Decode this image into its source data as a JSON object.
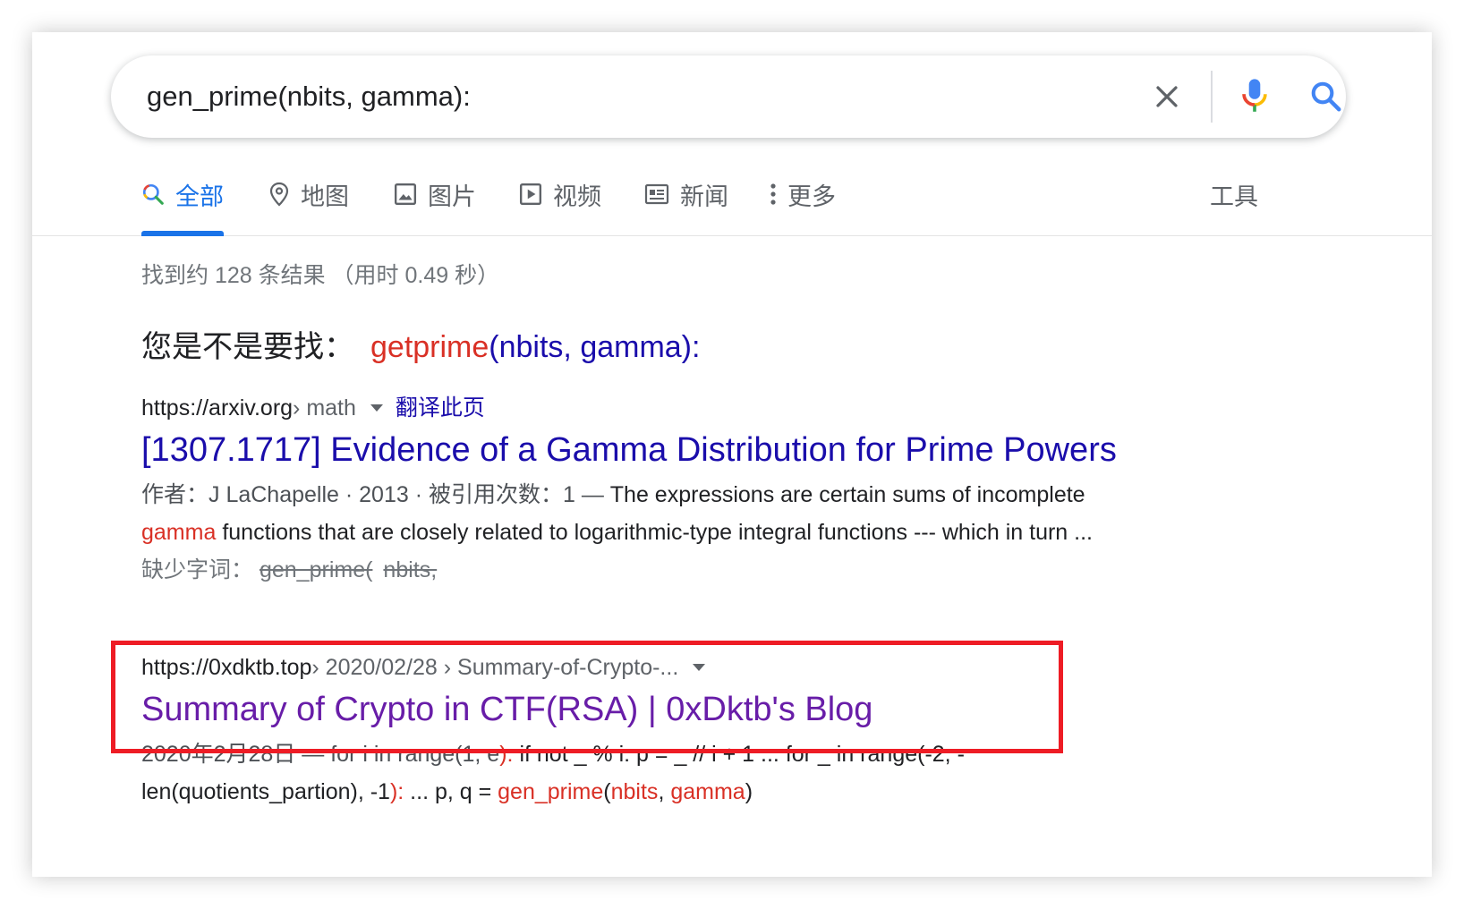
{
  "search": {
    "query": "gen_prime(nbits, gamma):"
  },
  "icons": {
    "clear": "close-icon",
    "mic": "microphone-icon",
    "search": "search-icon"
  },
  "tabs": [
    {
      "label": "全部",
      "icon": "search-icon",
      "active": true
    },
    {
      "label": "地图",
      "icon": "map-pin-icon"
    },
    {
      "label": "图片",
      "icon": "image-icon"
    },
    {
      "label": "视频",
      "icon": "play-icon"
    },
    {
      "label": "新闻",
      "icon": "news-icon"
    },
    {
      "label": "更多",
      "icon": "more-vert-icon"
    }
  ],
  "tools_label": "工具",
  "stats": "找到约 128 条结果 （用时 0.49 秒）",
  "did_you_mean": {
    "label": "您是不是要找：",
    "corrected_word": "getprime",
    "rest": "(nbits, gamma):"
  },
  "results": [
    {
      "site": "https://arxiv.org",
      "path": " › math",
      "translate": "翻译此页",
      "title": "[1307.1717] Evidence of a Gamma Distribution for Prime Powers",
      "meta": "作者：J LaChapelle · 2013 · 被引用次数：1 — ",
      "snippet_line1": "The expressions are certain sums of incomplete",
      "snippet_em": "gamma",
      "snippet_line2": " functions that are closely related to logarithmic-type integral functions --- which in turn ...",
      "missing_label": "缺少字词：",
      "missing_words": [
        "gen_prime(",
        "nbits,"
      ]
    },
    {
      "site": "https://0xdktb.top",
      "path": " › 2020/02/28 › Summary-of-Crypto-...",
      "title": "Summary of Crypto in CTF(RSA) | 0xDktb's Blog",
      "snippet_a": "2020年2月28日 — for i in range(1, e",
      "snippet_b": "): ",
      "snippet_c": "if not _ % i: p = _ // i + 1 ... for _ in range(-2, -",
      "snippet_d": "len(quotients_partion), -1",
      "snippet_e": "): ",
      "snippet_f": "... p, q = ",
      "snippet_g": "gen_prime",
      "snippet_h": "(",
      "snippet_i": "nbits",
      "snippet_j": ", ",
      "snippet_k": "gamma",
      "snippet_l": ")"
    }
  ],
  "colors": {
    "link": "#1a0dab",
    "visited": "#681da8",
    "accent": "#1a73e8",
    "highlight": "#d93025",
    "annotation_box": "#ee1c25"
  }
}
